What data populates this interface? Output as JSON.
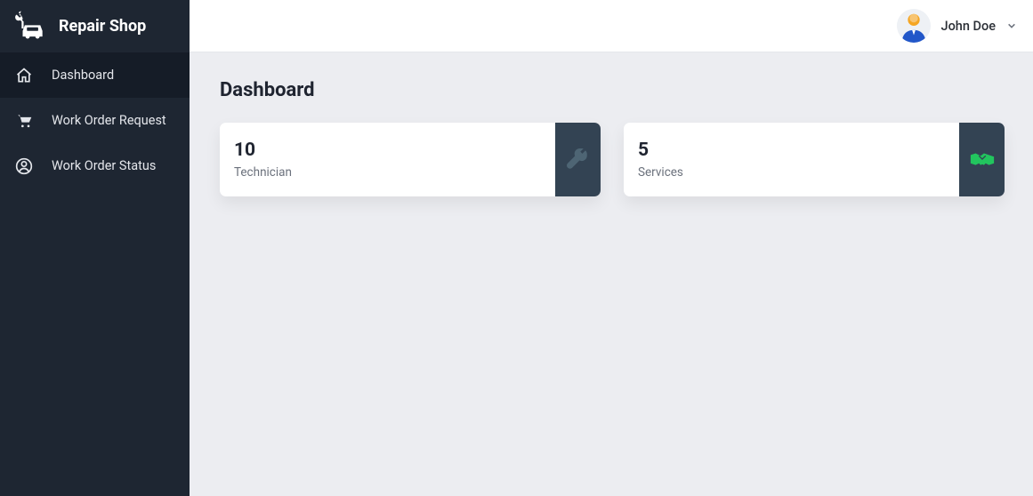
{
  "app": {
    "name": "Repair Shop"
  },
  "sidebar": {
    "items": [
      {
        "label": "Dashboard",
        "icon": "home-icon",
        "active": true
      },
      {
        "label": "Work Order Request",
        "icon": "cart-icon",
        "active": false
      },
      {
        "label": "Work Order Status",
        "icon": "user-icon",
        "active": false
      }
    ]
  },
  "header": {
    "user_name": "John Doe"
  },
  "page": {
    "title": "Dashboard"
  },
  "cards": [
    {
      "value": "10",
      "label": "Technician",
      "icon": "wrench-icon",
      "icon_color": "#4a6270"
    },
    {
      "value": "5",
      "label": "Services",
      "icon": "handshake-icon",
      "icon_color": "#22c55e"
    }
  ],
  "colors": {
    "sidebar_bg": "#1e2632",
    "sidebar_active_bg": "#151c27",
    "card_icon_bg": "#334353",
    "page_bg": "#ecedf1"
  }
}
